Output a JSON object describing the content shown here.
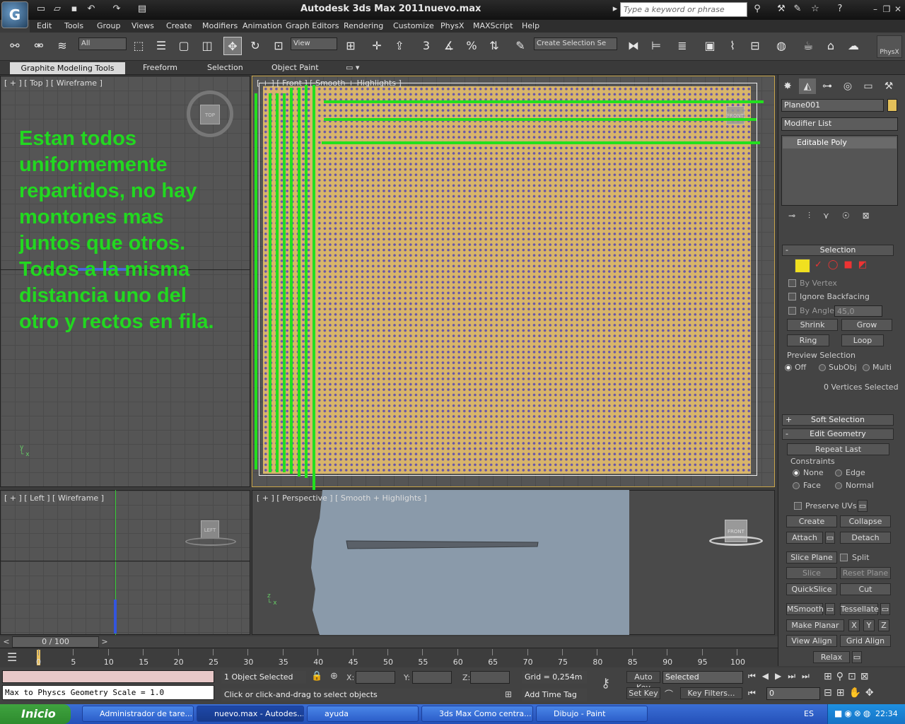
{
  "title": {
    "app": "Autodesk 3ds Max  2011",
    "file": "nuevo.max",
    "search_placeholder": "Type a keyword or phrase"
  },
  "menu": [
    "Edit",
    "Tools",
    "Group",
    "Views",
    "Create",
    "Modifiers",
    "Animation",
    "Graph Editors",
    "Rendering",
    "Customize",
    "PhysX",
    "MAXScript",
    "Help"
  ],
  "toolbar": {
    "filter": "All",
    "coord": "View",
    "selection_set": "Create Selection Se",
    "physx": "PhysX"
  },
  "ribbon": {
    "tabs": [
      "Graphite Modeling Tools",
      "Freeform",
      "Selection",
      "Object Paint"
    ]
  },
  "viewports": {
    "top": "[ + ] [ Top ] [ Wireframe ]",
    "front": "[ + ] [ Front ] [ Smooth + Highlights ]",
    "left": "[ + ] [ Left ] [ Wireframe ]",
    "perspective": "[ + ] [ Perspective ] [ Smooth + Highlights ]",
    "cube_top": "TOP",
    "cube_front": "FRONT",
    "cube_left": "LEFT"
  },
  "annotation": "Estan todos\nuniformemente\nrepartidos, no hay\nmontones mas\njuntos que otros.\nTodos a la misma\ndistancia uno del\notro y rectos en fila.",
  "command_panel": {
    "object_name": "Plane001",
    "modifier_list": "Modifier List",
    "stack_item": "Editable Poly",
    "selection": {
      "title": "Selection",
      "by_vertex": "By Vertex",
      "ignore_backfacing": "Ignore Backfacing",
      "by_angle": "By Angle:",
      "angle_value": "45,0",
      "shrink": "Shrink",
      "grow": "Grow",
      "ring": "Ring",
      "loop": "Loop",
      "preview": "Preview Selection",
      "off": "Off",
      "subobj": "SubObj",
      "multi": "Multi",
      "status": "0 Vertices Selected"
    },
    "soft_selection": "Soft Selection",
    "edit_geometry": {
      "title": "Edit Geometry",
      "repeat_last": "Repeat Last",
      "constraints": "Constraints",
      "none": "None",
      "edge": "Edge",
      "face": "Face",
      "normal": "Normal",
      "preserve_uvs": "Preserve UVs",
      "create": "Create",
      "collapse": "Collapse",
      "attach": "Attach",
      "detach": "Detach",
      "slice_plane": "Slice Plane",
      "split": "Split",
      "slice": "Slice",
      "reset_plane": "Reset Plane",
      "quickslice": "QuickSlice",
      "cut": "Cut",
      "msmooth": "MSmooth",
      "tessellate": "Tessellate",
      "make_planar": "Make Planar",
      "x": "X",
      "y": "Y",
      "z": "Z",
      "view_align": "View Align",
      "grid_align": "Grid Align",
      "relax": "Relax"
    },
    "rollout_plus": "+",
    "rollout_minus": "-"
  },
  "timeline": {
    "frame": "0 / 100",
    "ticks": [
      "0",
      "5",
      "10",
      "15",
      "20",
      "25",
      "30",
      "35",
      "40",
      "45",
      "50",
      "55",
      "60",
      "65",
      "70",
      "75",
      "80",
      "85",
      "90",
      "95",
      "100"
    ],
    "prev": "<",
    "next": ">"
  },
  "status": {
    "script": "Max to Physcs Geometry Scale = 1.0",
    "selected": "1 Object Selected",
    "prompt": "Click or click-and-drag to select objects",
    "x_label": "X:",
    "y_label": "Y:",
    "z_label": "Z:",
    "grid": "Grid = 0,254m",
    "add_time_tag": "Add Time Tag",
    "auto_key": "Auto Key",
    "set_key": "Set Key",
    "key_mode": "Selected",
    "key_filters": "Key Filters...",
    "frame_value": "0"
  },
  "taskbar": {
    "start": "Inicio",
    "items": [
      "Administrador de tare...",
      "nuevo.max - Autodes...",
      "ayuda",
      "3ds Max Como centra...",
      "Dibujo - Paint"
    ],
    "lang": "ES",
    "time": "22:34"
  },
  "colors": {
    "annotation": "#22d820",
    "plane": "#d8b56a",
    "vertex": "#6655aa",
    "perspective_bg": "#8a9aaa"
  }
}
